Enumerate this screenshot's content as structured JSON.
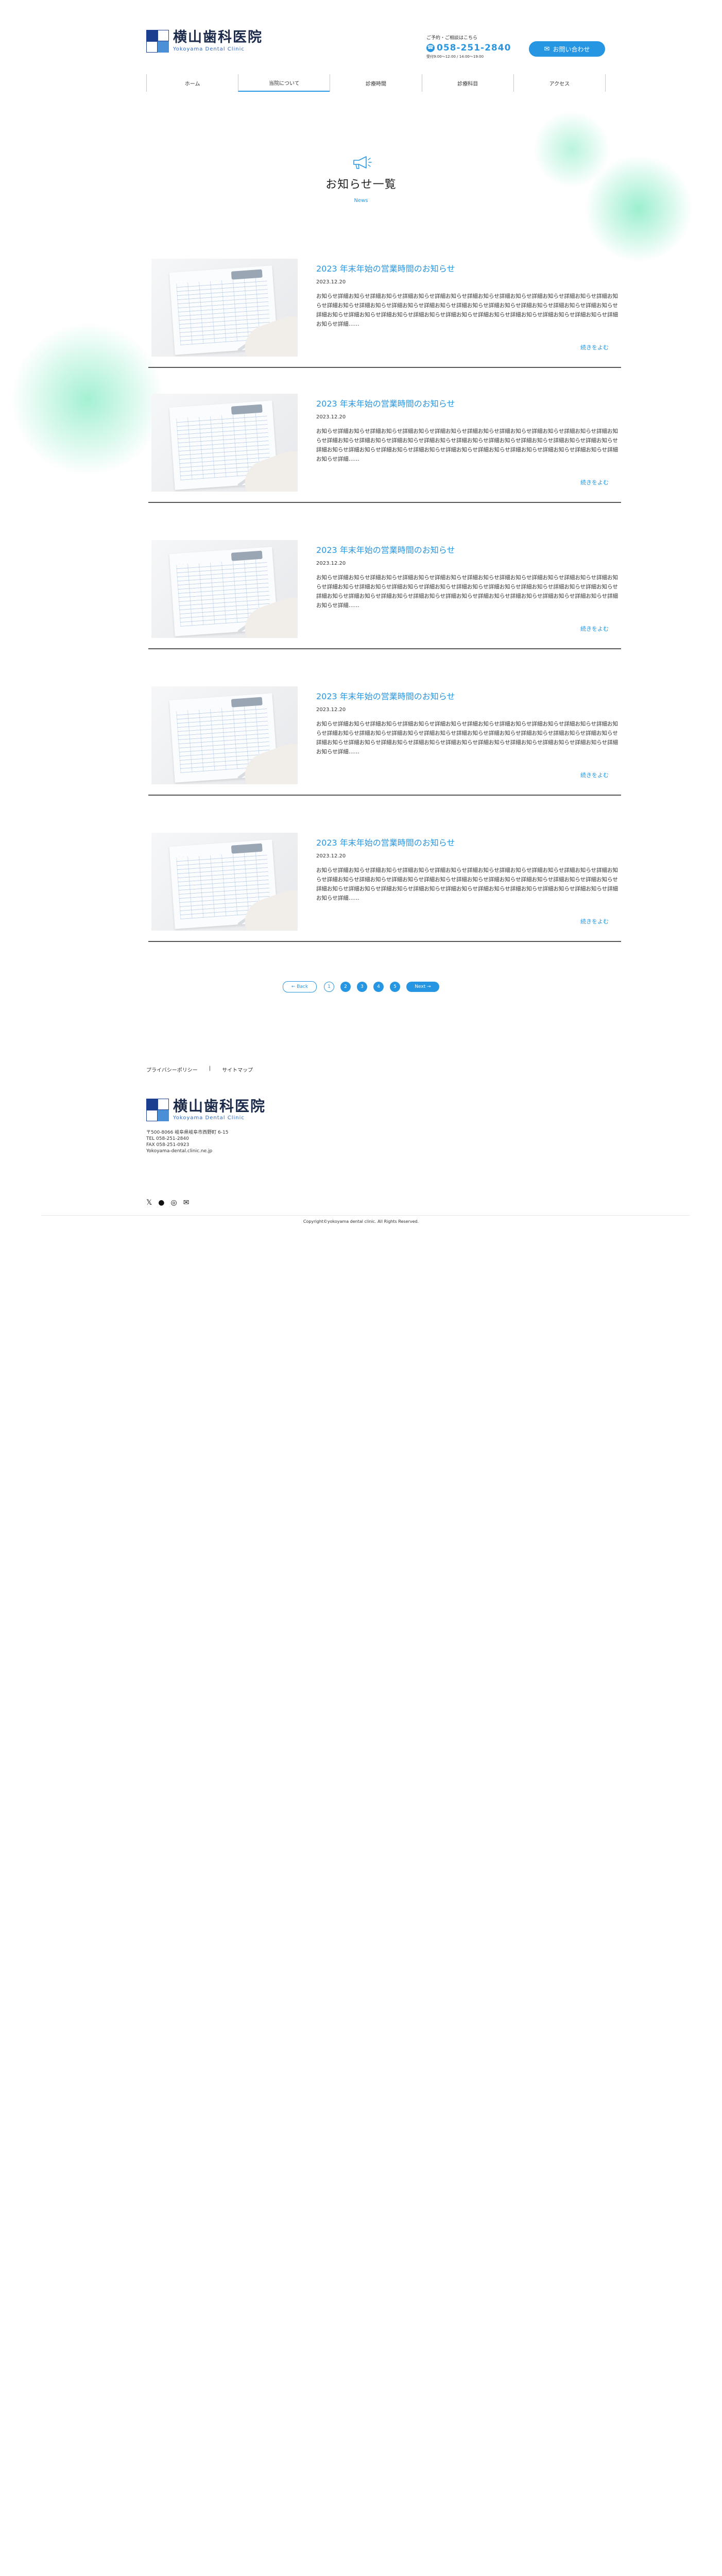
{
  "header": {
    "logo_jp": "横山歯科医院",
    "logo_en": "Yokoyama Dental Clinic",
    "tel_note": "ご予約・ご相談はこちら",
    "tel": "058-251-2840",
    "hours": "受付9:00〜12:00 / 14:00〜19:00",
    "contact_label": "お問い合わせ"
  },
  "nav": [
    "ホーム",
    "当院について",
    "診療時間",
    "診療科目",
    "アクセス"
  ],
  "page": {
    "title": "お知らせ一覧",
    "subtitle": "News"
  },
  "news": [
    {
      "title": "2023 年末年始の営業時間のお知らせ",
      "date": "2023.12.20",
      "excerpt": "お知らせ詳細お知らせ詳細お知らせ詳細お知らせ詳細お知らせ詳細お知らせ詳細お知らせ詳細お知らせ詳細お知らせ詳細お知らせ詳細お知らせ詳細お知らせ詳細お知らせ詳細お知らせ詳細お知らせ詳細お知らせ詳細お知らせ詳細お知らせ詳細お知らせ詳細お知らせ詳細お知らせ詳細お知らせ詳細お知らせ詳細お知らせ詳細お知らせ詳細お知らせ詳細お知らせ詳細お知らせ詳細お知らせ詳細……",
      "more": "続きをよむ"
    },
    {
      "title": "2023 年末年始の営業時間のお知らせ",
      "date": "2023.12.20",
      "excerpt": "お知らせ詳細お知らせ詳細お知らせ詳細お知らせ詳細お知らせ詳細お知らせ詳細お知らせ詳細お知らせ詳細お知らせ詳細お知らせ詳細お知らせ詳細お知らせ詳細お知らせ詳細お知らせ詳細お知らせ詳細お知らせ詳細お知らせ詳細お知らせ詳細お知らせ詳細お知らせ詳細お知らせ詳細お知らせ詳細お知らせ詳細お知らせ詳細お知らせ詳細お知らせ詳細お知らせ詳細お知らせ詳細お知らせ詳細……",
      "more": "続きをよむ"
    },
    {
      "title": "2023 年末年始の営業時間のお知らせ",
      "date": "2023.12.20",
      "excerpt": "お知らせ詳細お知らせ詳細お知らせ詳細お知らせ詳細お知らせ詳細お知らせ詳細お知らせ詳細お知らせ詳細お知らせ詳細お知らせ詳細お知らせ詳細お知らせ詳細お知らせ詳細お知らせ詳細お知らせ詳細お知らせ詳細お知らせ詳細お知らせ詳細お知らせ詳細お知らせ詳細お知らせ詳細お知らせ詳細お知らせ詳細お知らせ詳細お知らせ詳細お知らせ詳細お知らせ詳細お知らせ詳細お知らせ詳細……",
      "more": "続きをよむ"
    },
    {
      "title": "2023 年末年始の営業時間のお知らせ",
      "date": "2023.12.20",
      "excerpt": "お知らせ詳細お知らせ詳細お知らせ詳細お知らせ詳細お知らせ詳細お知らせ詳細お知らせ詳細お知らせ詳細お知らせ詳細お知らせ詳細お知らせ詳細お知らせ詳細お知らせ詳細お知らせ詳細お知らせ詳細お知らせ詳細お知らせ詳細お知らせ詳細お知らせ詳細お知らせ詳細お知らせ詳細お知らせ詳細お知らせ詳細お知らせ詳細お知らせ詳細お知らせ詳細お知らせ詳細お知らせ詳細お知らせ詳細……",
      "more": "続きをよむ"
    },
    {
      "title": "2023 年末年始の営業時間のお知らせ",
      "date": "2023.12.20",
      "excerpt": "お知らせ詳細お知らせ詳細お知らせ詳細お知らせ詳細お知らせ詳細お知らせ詳細お知らせ詳細お知らせ詳細お知らせ詳細お知らせ詳細お知らせ詳細お知らせ詳細お知らせ詳細お知らせ詳細お知らせ詳細お知らせ詳細お知らせ詳細お知らせ詳細お知らせ詳細お知らせ詳細お知らせ詳細お知らせ詳細お知らせ詳細お知らせ詳細お知らせ詳細お知らせ詳細お知らせ詳細お知らせ詳細お知らせ詳細……",
      "more": "続きをよむ"
    }
  ],
  "pagination": {
    "back": "← Back",
    "pages": [
      "1",
      "2",
      "3",
      "4",
      "5"
    ],
    "current": "1",
    "next": "Next →"
  },
  "footer": {
    "links": [
      "プライバシーポリシー",
      "|",
      "サイトマップ"
    ],
    "logo_jp": "横山歯科医院",
    "logo_en": "Yokoyama Dental Clinic",
    "address": [
      "〒500-8066 岐阜県岐阜市西野町 6-15",
      "TEL 058-251-2840",
      "FAX 058-251-0923",
      "Yokoyama-dental.clinic.ne.jp"
    ],
    "copyright": "Copyright©yokoyama dental clinic. All Rights Reserved."
  },
  "icons": {
    "social": [
      "x-icon",
      "facebook-icon",
      "instagram-icon",
      "mail-icon"
    ]
  },
  "colors": {
    "accent": "#2696e3",
    "brand_navy": "#1b3e8f",
    "glow": "#4ae2a8"
  }
}
